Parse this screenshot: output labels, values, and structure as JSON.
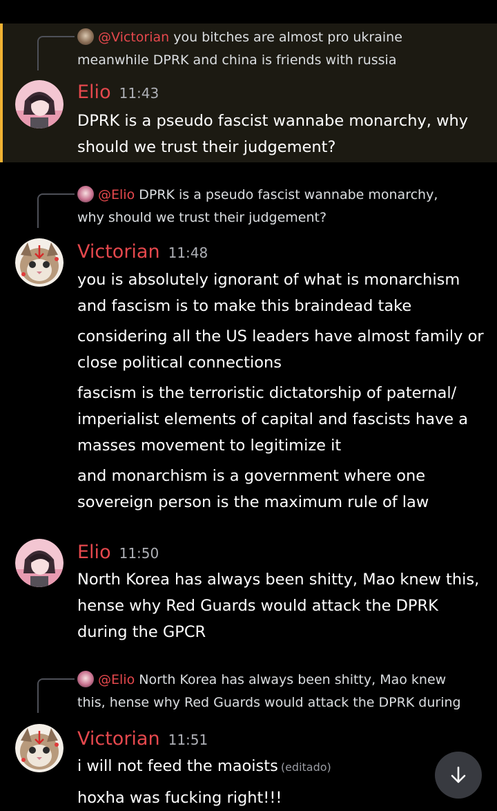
{
  "colors": {
    "accent": "#f0b232",
    "username": "#e5484d",
    "background": "#000000"
  },
  "messages": [
    {
      "reply_to": {
        "mention": "@Victorian",
        "lines": [
          "you bitches are almost pro ukraine",
          "meanwhile DPRK and china is friends with russia"
        ]
      },
      "author": "Elio",
      "time": "11:43",
      "lines": [
        "DPRK is a pseudo fascist wannabe monarchy, why",
        "should we trust their judgement?"
      ]
    },
    {
      "reply_to": {
        "mention": "@Elio",
        "lines": [
          "DPRK is a pseudo fascist wannabe monarchy,",
          "why should we trust their judgement?"
        ]
      },
      "author": "Victorian",
      "time": "11:48",
      "paragraphs": [
        [
          "you is absolutely ignorant of what is monarchism",
          "and fascism is to make this braindead take"
        ],
        [
          "considering all the US leaders have almost family or",
          "close political connections"
        ],
        [
          "fascism is the terroristic dictatorship of paternal/",
          "imperialist elements of capital and fascists have a",
          "masses movement to legitimize it"
        ],
        [
          "and monarchism is a government where one",
          "sovereign person is the maximum rule of law"
        ]
      ]
    },
    {
      "author": "Elio",
      "time": "11:50",
      "lines": [
        "North Korea has always been shitty, Mao knew this,",
        "hense why Red Guards would attack the DPRK",
        "during the GPCR"
      ]
    },
    {
      "reply_to": {
        "mention": "@Elio",
        "lines": [
          "North Korea has always been shitty, Mao knew",
          "this, hense why Red Guards would attack the DPRK during"
        ]
      },
      "author": "Victorian",
      "time": "11:51",
      "line1": "i will not feed the maoists",
      "edited": "(editado)",
      "line2": "hoxha was fucking right!!!"
    }
  ],
  "scroll_button": {
    "icon": "arrow-down-icon"
  }
}
